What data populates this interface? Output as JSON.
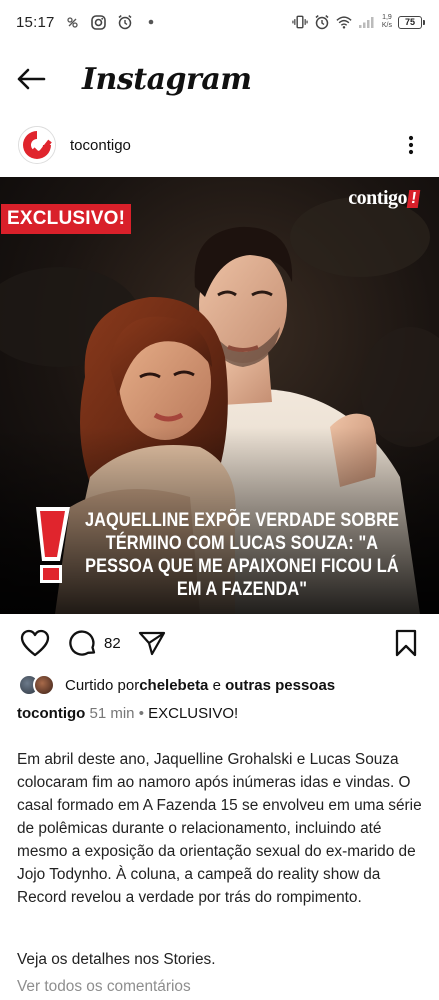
{
  "status_bar": {
    "time": "15:17",
    "net_speed_value": "1,9",
    "net_speed_unit": "K/s",
    "battery": "75",
    "icons": [
      "sim-status-icon",
      "instagram-notification-icon",
      "alarm-icon",
      "dot-icon",
      "vibrate-icon",
      "alarm-icon",
      "wifi-icon",
      "signal-icon",
      "battery-icon"
    ]
  },
  "header": {
    "title": "Instagram",
    "back_icon": "arrow-left-icon"
  },
  "post": {
    "username": "tocontigo",
    "image": {
      "tag": "EXCLUSIVO!",
      "brand": "contigo",
      "brand_bang": "!",
      "headline": "JAQUELLINE EXPÕE VERDADE SOBRE TÉRMINO COM LUCAS SOUZA: \"A PESSOA QUE ME APAIXONEI FICOU LÁ EM A FAZENDA\"",
      "accent_color": "#d9202a"
    },
    "actions": {
      "comment_count": "82"
    },
    "likes": {
      "prefix": "Curtido por ",
      "user": "chelebeta",
      "connector": " e ",
      "others": "outras pessoas"
    },
    "caption": {
      "user": "tocontigo",
      "time": "51 min",
      "separator": " • ",
      "headline": "EXCLUSIVO!",
      "body": "Em abril deste ano, Jaquelline Grohalski e Lucas Souza colocaram fim ao namoro após inúmeras idas e vindas. O casal formado em A Fazenda 15 se envolveu em uma série de polêmicas durante o relacionamento, incluindo até mesmo a exposição da orientação sexual do ex-marido de Jojo Todynho. À coluna, a campeã do reality show da Record revelou a verdade por trás do rompimento.",
      "extra": "Veja os detalhes nos Stories."
    },
    "view_comments": "Ver todos os comentários"
  }
}
